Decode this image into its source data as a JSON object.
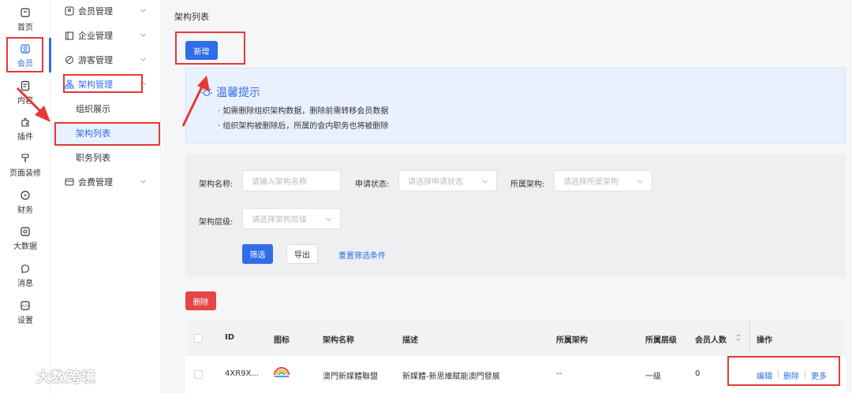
{
  "rail": {
    "items": [
      {
        "label": "首页",
        "icon": "home-icon"
      },
      {
        "label": "会员",
        "icon": "member-icon"
      },
      {
        "label": "内容",
        "icon": "content-icon"
      },
      {
        "label": "插件",
        "icon": "plugin-icon"
      },
      {
        "label": "页面装修",
        "icon": "page-decor-icon"
      },
      {
        "label": "财务",
        "icon": "finance-icon"
      },
      {
        "label": "大数据",
        "icon": "bigdata-icon"
      },
      {
        "label": "消息",
        "icon": "message-icon"
      },
      {
        "label": "设置",
        "icon": "settings-icon"
      }
    ],
    "active_index": 1
  },
  "submenu": {
    "groups": [
      {
        "label": "会员管理"
      },
      {
        "label": "企业管理"
      },
      {
        "label": "游客管理"
      },
      {
        "label": "架构管理"
      },
      {
        "label": "会费管理"
      }
    ],
    "children": [
      {
        "label": "组织展示"
      },
      {
        "label": "架构列表"
      },
      {
        "label": "职务列表"
      }
    ]
  },
  "main": {
    "breadcrumb": "架构列表",
    "add_button": "新增",
    "tips": {
      "title": "温馨提示",
      "lines": [
        "·  如需删除组织架构数据，删除前需转移会员数据",
        "·  组织架构被删除后，所属的会内职务也将被删除"
      ]
    },
    "filter": {
      "name_label": "架构名称:",
      "name_placeholder": "请输入架构名称",
      "status_label": "申请状态:",
      "status_placeholder": "请选择申请状态",
      "parent_label": "所属架构:",
      "parent_placeholder": "请选择所属架构",
      "level_label": "架构层级:",
      "level_placeholder": "请选择架构层级",
      "filter_button": "筛选",
      "export_button": "导出",
      "reset_link": "重置筛选条件"
    },
    "delete_button": "删除",
    "table": {
      "headers": [
        "ID",
        "图标",
        "架构名称",
        "描述",
        "所属架构",
        "所属层级",
        "会员人数",
        "操作"
      ],
      "rows": [
        {
          "id": "4XR9X...",
          "name": "澳門新媒體聯盟",
          "desc": "新媒體-新思維賦能澳門發展",
          "parent": "--",
          "level": "一级",
          "count": "0",
          "ops": [
            "编辑",
            "删除",
            "更多"
          ]
        }
      ]
    }
  },
  "watermark": "大数跨境",
  "colors": {
    "primary": "#2f6ee8",
    "danger": "#e64545",
    "annotation": "#e53935"
  }
}
